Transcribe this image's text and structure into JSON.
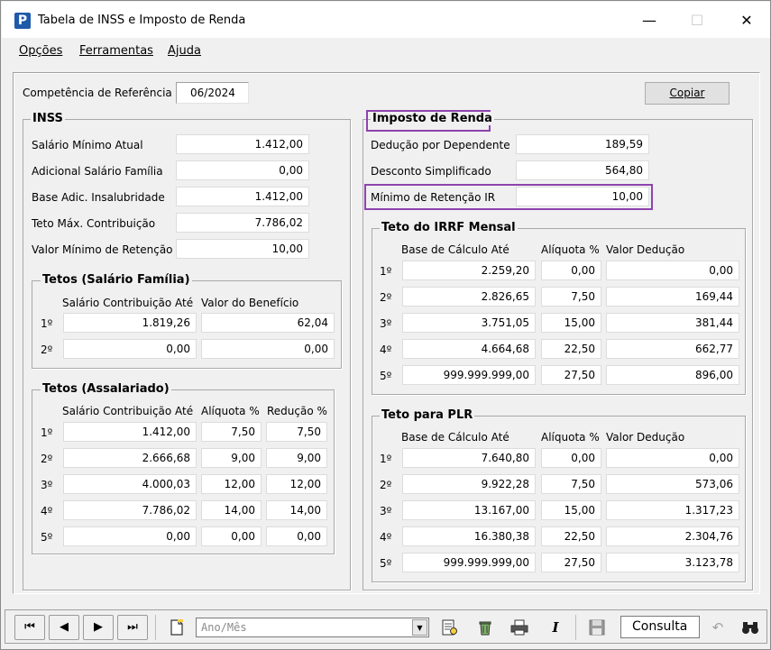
{
  "window": {
    "title": "Tabela de INSS e Imposto de Renda",
    "icon": "P",
    "minimize": "—",
    "maximize": "☐",
    "close": "✕"
  },
  "menu": [
    {
      "label": "Opções"
    },
    {
      "label": "Ferramentas"
    },
    {
      "label": "Ajuda"
    }
  ],
  "top": {
    "competencia_label": "Competência de Referência",
    "competencia_value": "06/2024",
    "copiar_label": "Copiar"
  },
  "inss": {
    "title": "INSS",
    "rows": [
      {
        "label": "Salário Mínimo Atual",
        "value": "1.412,00"
      },
      {
        "label": "Adicional Salário Família",
        "value": "0,00"
      },
      {
        "label": "Base Adic. Insalubridade",
        "value": "1.412,00"
      },
      {
        "label": "Teto Máx. Contribuição",
        "value": "7.786,02"
      },
      {
        "label": "Valor Mínimo de Retenção",
        "value": "10,00"
      }
    ]
  },
  "tetos_familia": {
    "title": "Tetos (Salário Família)",
    "headers": [
      "Salário Contribuição Até",
      "Valor do Benefício"
    ],
    "rows": [
      {
        "ord": "1º",
        "salario": "1.819,26",
        "beneficio": "62,04"
      },
      {
        "ord": "2º",
        "salario": "0,00",
        "beneficio": "0,00"
      }
    ]
  },
  "tetos_assalariado": {
    "title": "Tetos (Assalariado)",
    "headers": [
      "Salário Contribuição Até",
      "Alíquota %",
      "Redução %"
    ],
    "rows": [
      {
        "ord": "1º",
        "salario": "1.412,00",
        "aliquota": "7,50",
        "reducao": "7,50"
      },
      {
        "ord": "2º",
        "salario": "2.666,68",
        "aliquota": "9,00",
        "reducao": "9,00"
      },
      {
        "ord": "3º",
        "salario": "4.000,03",
        "aliquota": "12,00",
        "reducao": "12,00"
      },
      {
        "ord": "4º",
        "salario": "7.786,02",
        "aliquota": "14,00",
        "reducao": "14,00"
      },
      {
        "ord": "5º",
        "salario": "0,00",
        "aliquota": "0,00",
        "reducao": "0,00"
      }
    ]
  },
  "ir": {
    "title": "Imposto de Renda",
    "rows": [
      {
        "label": "Dedução por Dependente",
        "value": "189,59"
      },
      {
        "label": "Desconto Simplificado",
        "value": "564,80"
      },
      {
        "label": "Mínimo de Retenção IR",
        "value": "10,00"
      }
    ]
  },
  "irrf": {
    "title": "Teto do IRRF Mensal",
    "headers": [
      "Base de Cálculo Até",
      "Alíquota %",
      "Valor Dedução"
    ],
    "rows": [
      {
        "ord": "1º",
        "base": "2.259,20",
        "aliquota": "0,00",
        "deducao": "0,00"
      },
      {
        "ord": "2º",
        "base": "2.826,65",
        "aliquota": "7,50",
        "deducao": "169,44"
      },
      {
        "ord": "3º",
        "base": "3.751,05",
        "aliquota": "15,00",
        "deducao": "381,44"
      },
      {
        "ord": "4º",
        "base": "4.664,68",
        "aliquota": "22,50",
        "deducao": "662,77"
      },
      {
        "ord": "5º",
        "base": "999.999.999,00",
        "aliquota": "27,50",
        "deducao": "896,00"
      }
    ]
  },
  "plr": {
    "title": "Teto para PLR",
    "headers": [
      "Base de Cálculo Até",
      "Alíquota %",
      "Valor Dedução"
    ],
    "rows": [
      {
        "ord": "1º",
        "base": "7.640,80",
        "aliquota": "0,00",
        "deducao": "0,00"
      },
      {
        "ord": "2º",
        "base": "9.922,28",
        "aliquota": "7,50",
        "deducao": "573,06"
      },
      {
        "ord": "3º",
        "base": "13.167,00",
        "aliquota": "15,00",
        "deducao": "1.317,23"
      },
      {
        "ord": "4º",
        "base": "16.380,38",
        "aliquota": "22,50",
        "deducao": "2.304,76"
      },
      {
        "ord": "5º",
        "base": "999.999.999,00",
        "aliquota": "27,50",
        "deducao": "3.123,78"
      }
    ]
  },
  "statusbar": {
    "first": "⏮",
    "prev": "◀",
    "next": "▶",
    "last": "⏭",
    "combo_placeholder": "Ano/Mês",
    "combo_arrow": "▼",
    "mode": "Consulta",
    "icons": [
      "new-document-icon",
      "report-icon",
      "recycle-icon",
      "print-icon",
      "italic-icon",
      "save-icon",
      "undo-icon",
      "binoculars-icon"
    ],
    "italic": "I",
    "undo": "↶"
  },
  "colors": {
    "highlight": "#8e44ad",
    "window_bg": "#f0f0f0",
    "app_icon": "#1e5aa8"
  }
}
